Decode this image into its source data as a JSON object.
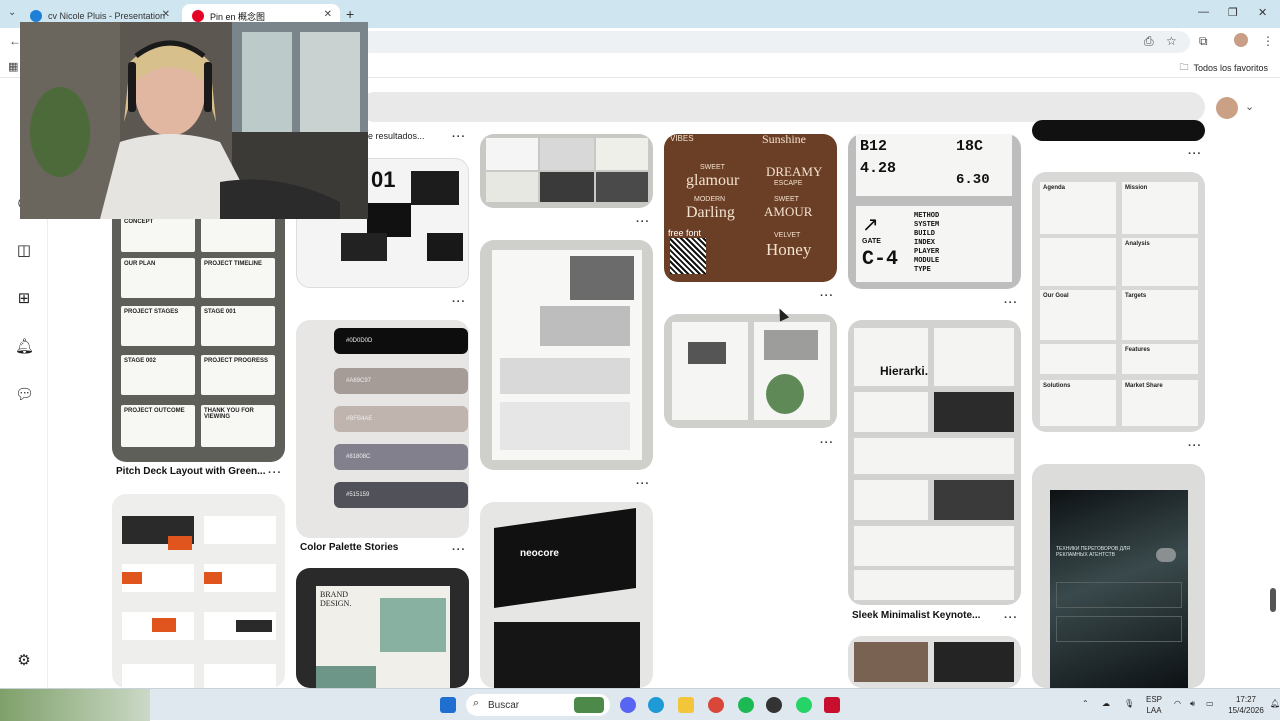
{
  "browser": {
    "tabs": [
      {
        "title": "cv Nicole Pluis - Presentation",
        "favicon_color": "#1e7fd6"
      },
      {
        "title": "Pin en 概念图",
        "favicon_color": "#e60023"
      }
    ],
    "bookmarks_label": "Todos los favoritos"
  },
  "pinterest": {
    "partial_title": "e resultados...",
    "pins": [
      {
        "title": "Pitch Deck Layout with Green..."
      },
      {
        "title": "Color Palette Stories"
      },
      {
        "title": "Sleek Minimalist Keynote..."
      }
    ],
    "pitch_deck": {
      "slides": [
        "CONCEPT",
        "OUR PLAN",
        "PROJECT TIMELINE",
        "PROJECT STAGES",
        "STAGE 001",
        "STAGE 002",
        "PROJECT PROGRESS",
        "PROJECT OUTCOME",
        "THANK YOU FOR VIEWING"
      ]
    },
    "palette": {
      "colors": [
        {
          "hex": "#0D0D0D",
          "label": "#0D0D0D"
        },
        {
          "hex": "#A69C97",
          "label": "#A69C97"
        },
        {
          "hex": "#BFB4AE",
          "label": "#BFB4AE"
        },
        {
          "hex": "#81808C",
          "label": "#81808C"
        },
        {
          "hex": "#515159",
          "label": "#515159"
        }
      ]
    },
    "fonts_pin": {
      "words": [
        "VIBES",
        "Sunshine",
        "SWEET",
        "glamour",
        "DREAMY",
        "ESCAPE",
        "MODERN",
        "Darling",
        "SWEET",
        "AMOUR",
        "VELVET",
        "Honey"
      ],
      "badge": "free font"
    },
    "ticket": {
      "codes": [
        "B12",
        "18C",
        "4.28",
        "6.30",
        "C-4",
        "GATE"
      ],
      "words": [
        "METHOD",
        "SYSTEM",
        "BUILD",
        "INDEX",
        "PLAYER",
        "MODULE",
        "TYPE"
      ]
    },
    "hierarki": {
      "title": "Hierarki."
    },
    "agenda_pin": {
      "labels": [
        "Agenda",
        "Mission",
        "Analysis",
        "Our Goal",
        "Targets",
        "Features",
        "Solutions",
        "Market Share"
      ]
    },
    "brand_design": {
      "title": "BRAND DESIGN."
    },
    "agency_pin": {
      "heading": "ТЕХНИКИ ПЕРЕГОВОРОВ ДЛЯ РЕКЛАМНЫХ АГЕНТСТВ"
    },
    "book_pin": {
      "brand": "neocore"
    }
  },
  "taskbar": {
    "search_placeholder": "Buscar",
    "lang": "ESP",
    "lang2": "LAA",
    "time": "17:27",
    "date": "15/4/2026"
  }
}
